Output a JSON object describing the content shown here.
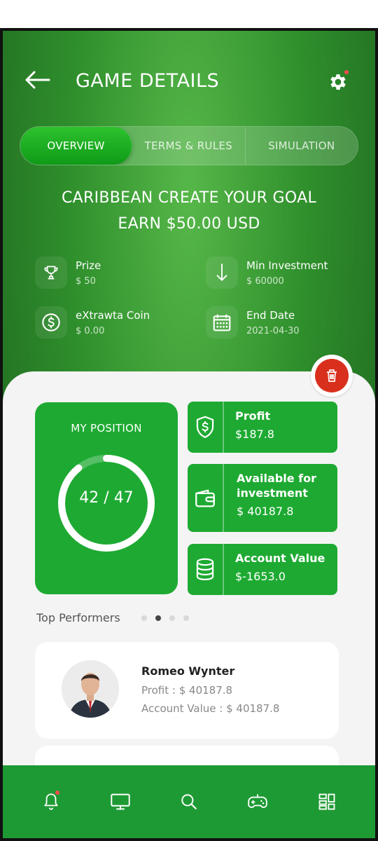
{
  "header": {
    "title": "GAME DETAILS",
    "back_icon": "arrow-left-icon",
    "settings_icon": "gear-icon"
  },
  "tabs": [
    {
      "label": "OVERVIEW",
      "active": true
    },
    {
      "label": "TERMS & RULES",
      "active": false
    },
    {
      "label": "SIMULATION",
      "active": false
    }
  ],
  "headline": {
    "line1": "CARIBBEAN CREATE YOUR GOAL",
    "line2": "EARN $50.00 USD"
  },
  "info": {
    "prize": {
      "label": "Prize",
      "value": "$ 50",
      "icon": "trophy-icon"
    },
    "min_investment": {
      "label": "Min Investment",
      "value": "$ 60000",
      "icon": "arrow-down-icon"
    },
    "coin": {
      "label": "eXtrawta Coin",
      "value": "$ 0.00",
      "icon": "dollar-coin-icon"
    },
    "end_date": {
      "label": "End Date",
      "value": "2021-04-30",
      "icon": "calendar-icon"
    }
  },
  "position": {
    "title": "MY POSITION",
    "value": "42 / 47",
    "rank": 42,
    "total": 47
  },
  "stats": {
    "profit": {
      "label": "Profit",
      "value": "$187.8",
      "icon": "shield-dollar-icon"
    },
    "available": {
      "label": "Available for investment",
      "value": "$ 40187.8",
      "icon": "wallet-icon"
    },
    "account_value": {
      "label": "Account Value",
      "value": "$-1653.0",
      "icon": "coin-stack-icon"
    }
  },
  "top_performers": {
    "title": "Top Performers",
    "active_dot": 1,
    "items": [
      {
        "name": "Romeo Wynter",
        "profit": "Profit : $ 40187.8",
        "account_value": "Account Value : $ 40187.8"
      }
    ]
  },
  "colors": {
    "accent": "#1eaa32",
    "danger": "#d9301d",
    "nav": "#1e9a34"
  },
  "nav": [
    "bell-icon",
    "monitor-icon",
    "search-icon",
    "gamepad-icon",
    "dashboard-icon"
  ]
}
